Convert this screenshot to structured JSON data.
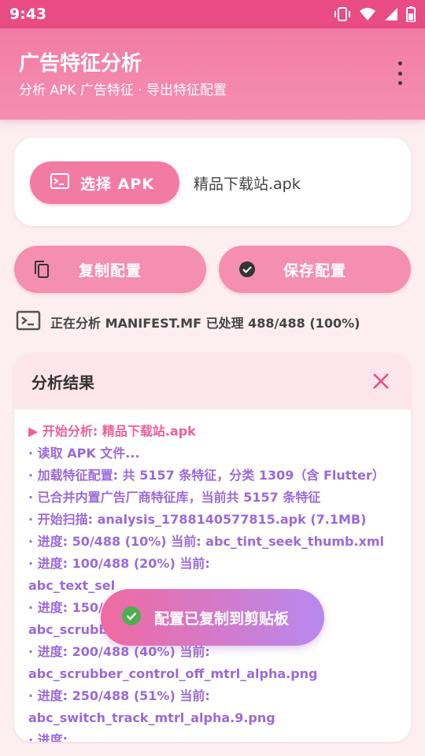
{
  "status_bar": {
    "time": "9:43",
    "icons": [
      "vibrate-icon",
      "wifi-icon",
      "signal-icon",
      "battery-icon"
    ]
  },
  "app_bar": {
    "title": "广告特征分析",
    "subtitle": "分析 APK 广告特征 · 导出特征配置",
    "menu_icon": "more-vert-icon"
  },
  "select_card": {
    "button_label": "选择 APK",
    "button_icon": "terminal-icon",
    "file_name": "精品下载站.apk"
  },
  "actions": {
    "copy_label": "复制配置",
    "copy_icon": "copy-icon",
    "save_label": "保存配置",
    "save_icon": "check-circle-icon"
  },
  "progress": {
    "icon": "terminal-icon",
    "text": "正在分析 MANIFEST.MF 已处理 488/488 (100%)"
  },
  "result": {
    "title": "分析结果",
    "close_icon": "close-icon",
    "log_lines": [
      "▶ 开始分析: 精品下载站.apk",
      "· 读取 APK 文件...",
      "· 加载特征配置: 共 5157 条特征，分类 1309（含 Flutter）",
      "· 已合并内置广告厂商特征库，当前共 5157 条特征",
      "· 开始扫描: analysis_1788140577815.apk (7.1MB)",
      "· 进度: 50/488 (10%) 当前: abc_tint_seek_thumb.xml",
      "· 进度: 100/488 (20%) 当前:",
      "abc_text_sel",
      "· 进度: 150/",
      "abc_scrubber                               05.png",
      "· 进度: 200/488 (40%) 当前:",
      "abc_scrubber_control_off_mtrl_alpha.png",
      "· 进度: 250/488 (51%) 当前:",
      "abc_switch_track_mtrl_alpha.9.png",
      "· 进度: ..."
    ]
  },
  "toast": {
    "icon": "check-circle-icon",
    "text": "配置已复制到剪贴板"
  },
  "colors": {
    "status_bar": "#e94b85",
    "app_bar": "#f48fb1",
    "accent": "#f27ba4",
    "log_text": "#9a6ad9",
    "log_first": "#ef5f96",
    "background": "#fdeef2"
  }
}
